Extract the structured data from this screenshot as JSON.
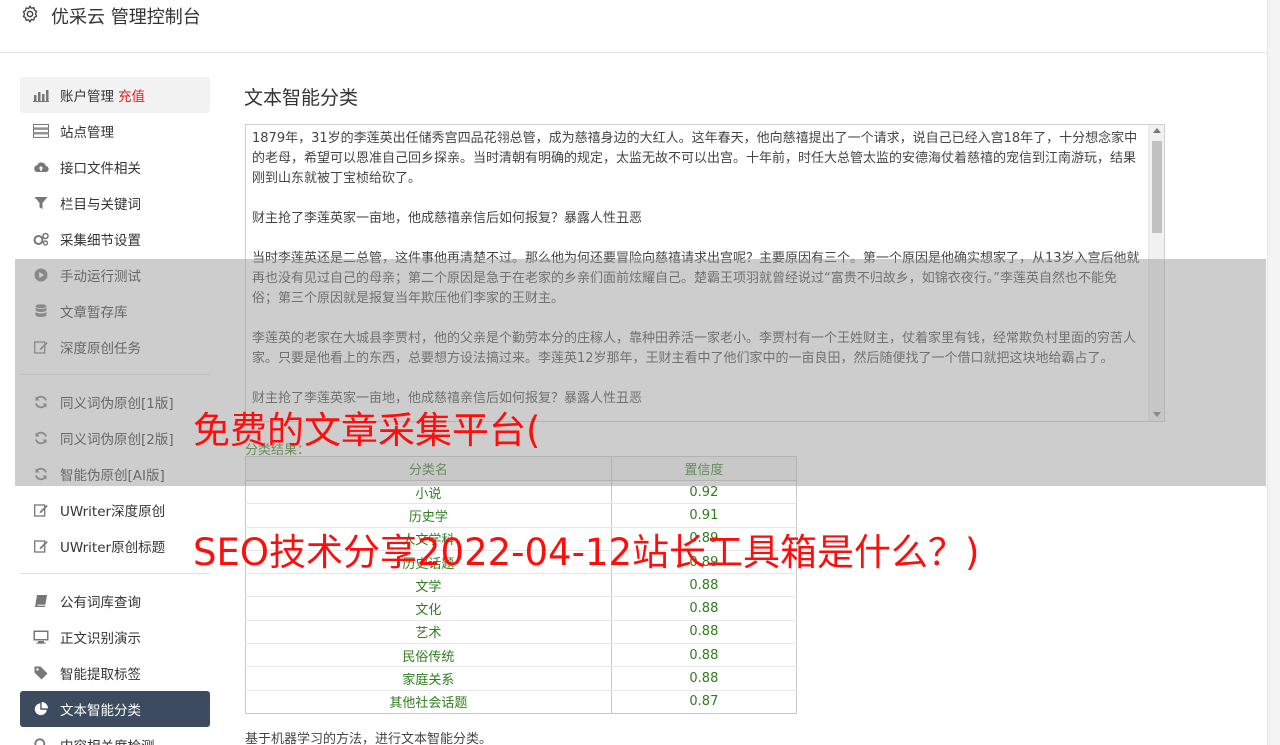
{
  "header": {
    "title": "优采云 管理控制台"
  },
  "sidebar": {
    "group1": [
      {
        "label": "账户管理",
        "badge": "充值",
        "icon": "bar-chart-icon"
      },
      {
        "label": "站点管理",
        "icon": "server-icon"
      },
      {
        "label": "接口文件相关",
        "icon": "cloud-upload-icon"
      },
      {
        "label": "栏目与关键词",
        "icon": "filter-icon"
      },
      {
        "label": "采集细节设置",
        "icon": "gears-icon"
      },
      {
        "label": "手动运行测试",
        "icon": "play-icon"
      },
      {
        "label": "文章暂存库",
        "icon": "database-icon"
      },
      {
        "label": "深度原创任务",
        "icon": "edit-icon"
      }
    ],
    "group2": [
      {
        "label": "同义词伪原创[1版]",
        "icon": "refresh-icon"
      },
      {
        "label": "同义词伪原创[2版]",
        "icon": "refresh-icon"
      },
      {
        "label": "智能伪原创[AI版]",
        "icon": "refresh-icon"
      },
      {
        "label": "UWriter深度原创",
        "icon": "edit-icon"
      },
      {
        "label": "UWriter原创标题",
        "icon": "edit-icon"
      }
    ],
    "group3": [
      {
        "label": "公有词库查询",
        "icon": "book-icon"
      },
      {
        "label": "正文识别演示",
        "icon": "monitor-icon"
      },
      {
        "label": "智能提取标签",
        "icon": "tag-icon"
      },
      {
        "label": "文本智能分类",
        "icon": "pie-chart-icon"
      },
      {
        "label": "内容相关度检测",
        "icon": "search-icon"
      }
    ]
  },
  "main": {
    "title": "文本智能分类",
    "text_paragraphs": [
      "1879年，31岁的李莲英出任储秀宫四品花翎总管，成为慈禧身边的大红人。这年春天，他向慈禧提出了一个请求，说自己已经入宫18年了，十分想念家中的老母，希望可以恩准自己回乡探亲。当时清朝有明确的规定，太监无故不可以出宫。十年前，时任大总管太监的安德海仗着慈禧的宠信到江南游玩，结果刚到山东就被丁宝桢给砍了。",
      "财主抢了李莲英家一亩地，他成慈禧亲信后如何报复？暴露人性丑恶",
      "当时李莲英还是二总管，这件事他再清楚不过。那么他为何还要冒险向慈禧请求出宫呢？主要原因有三个。第一个原因是他确实想家了，从13岁入宫后他就再也没有见过自己的母亲；第二个原因是急于在老家的乡亲们面前炫耀自己。楚霸王项羽就曾经说过“富贵不归故乡，如锦衣夜行。”李莲英自然也不能免俗；第三个原因就是报复当年欺压他们李家的王财主。",
      "李莲英的老家在大城县李贾村，他的父亲是个勤劳本分的庄稼人，靠种田养活一家老小。李贾村有一个王姓财主，仗着家里有钱，经常欺负村里面的穷苦人家。只要是他看上的东西，总要想方设法搞过来。李莲英12岁那年，王财主看中了他们家中的一亩良田，然后随便找了一个借口就把这块地给霸占了。",
      "财主抢了李莲英家一亩地，他成慈禧亲信后如何报复？暴露人性丑恶"
    ],
    "result_label": "分类结果：",
    "table": {
      "headers": [
        "分类名",
        "置信度"
      ],
      "rows": [
        [
          "小说",
          "0.92"
        ],
        [
          "历史学",
          "0.91"
        ],
        [
          "人文学科",
          "0.89"
        ],
        [
          "历史话题",
          "0.89"
        ],
        [
          "文学",
          "0.88"
        ],
        [
          "文化",
          "0.88"
        ],
        [
          "艺术",
          "0.88"
        ],
        [
          "民俗传统",
          "0.88"
        ],
        [
          "家庭关系",
          "0.88"
        ],
        [
          "其他社会话题",
          "0.87"
        ]
      ]
    },
    "footnote": "基于机器学习的方法，进行文本智能分类。"
  },
  "overlay": {
    "line1": "免费的文章采集平台(",
    "line2": "SEO技术分享2022-04-12站长工具箱是什么？)",
    "text_color": "#ff0d0d"
  },
  "colors": {
    "accent": "#3c4b5f",
    "badge": "#e02020",
    "result": "#2e7d1c"
  }
}
